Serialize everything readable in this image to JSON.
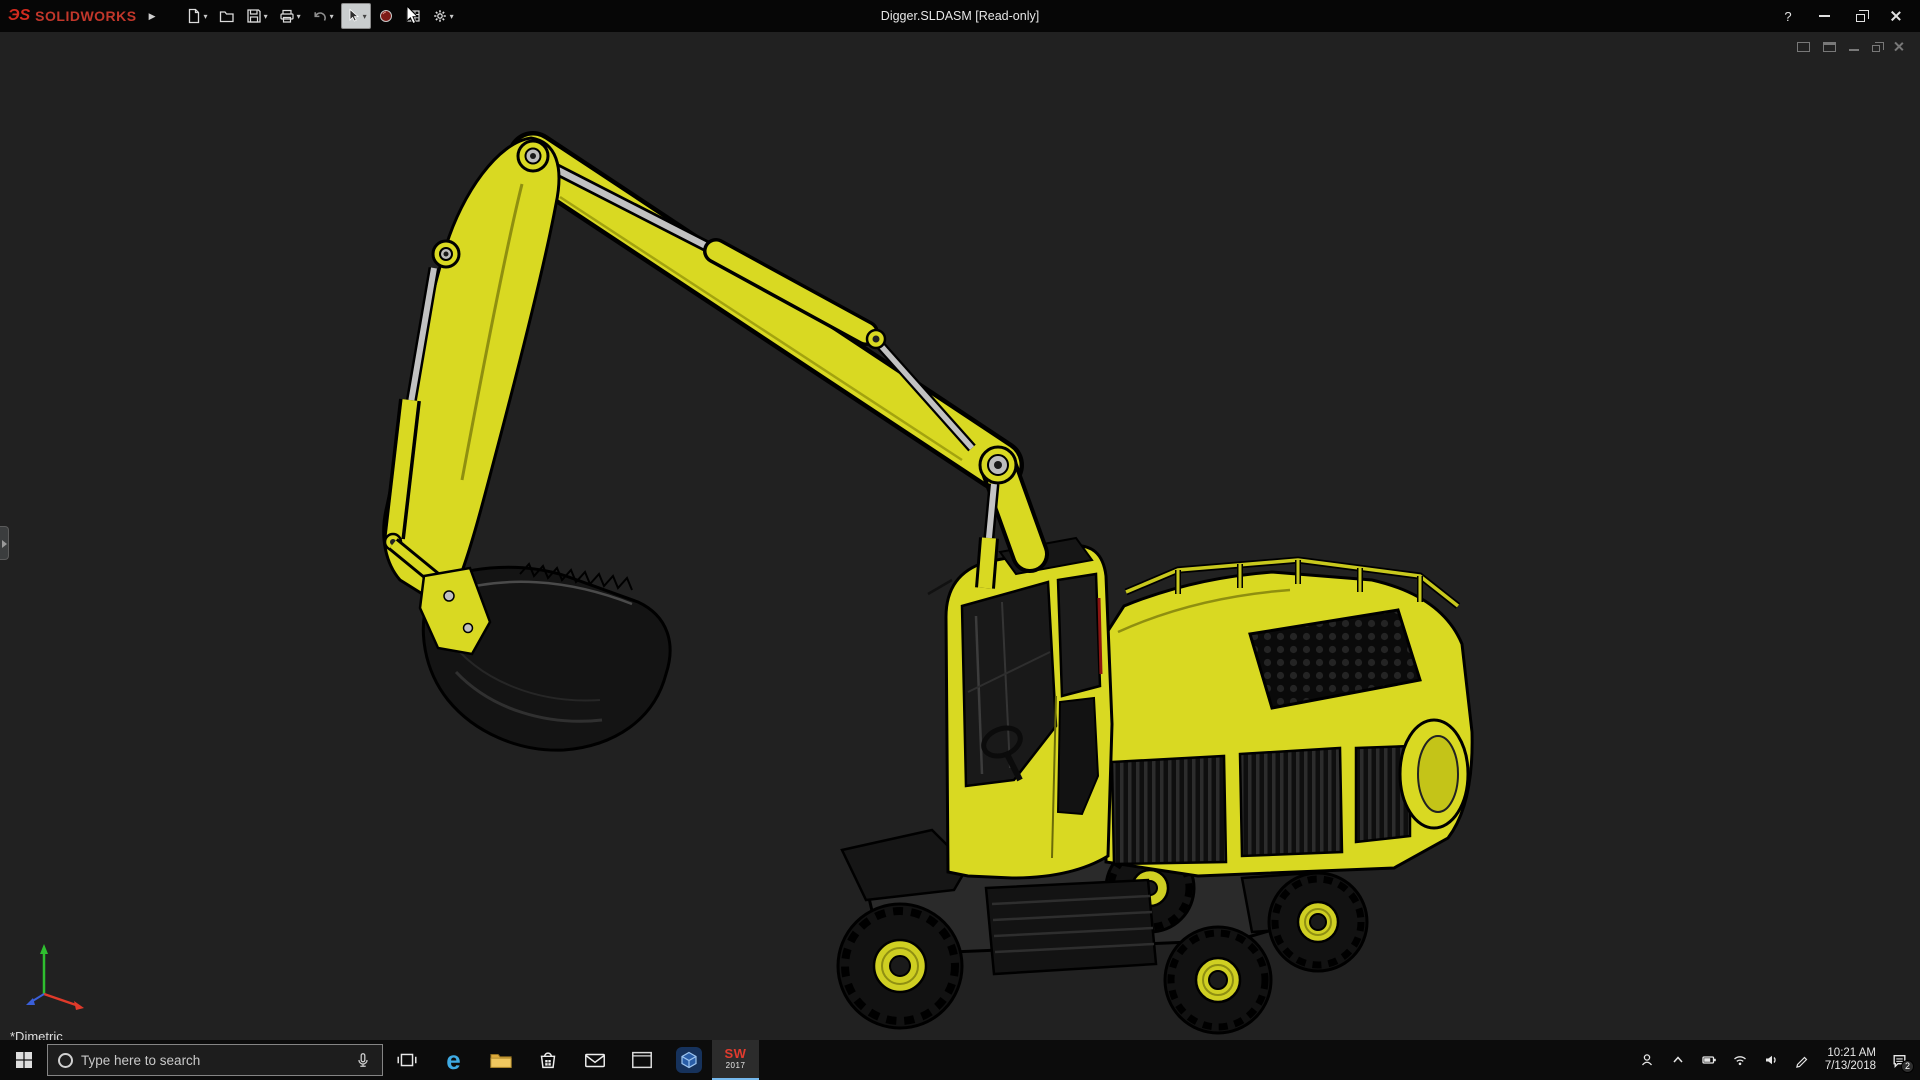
{
  "titlebar": {
    "logo_glyph": "ЭS",
    "brand": "SOLIDWORKS",
    "document_title": "Digger.SLDASM [Read-only]",
    "help_label": "?"
  },
  "glyphs": {
    "dropdown_caret": "▾",
    "flyout_arrow": "▶"
  },
  "toolbar": {
    "buttons": [
      "new-document",
      "open",
      "save",
      "print",
      "undo",
      "select",
      "rebuild",
      "file-properties",
      "options"
    ]
  },
  "viewport": {
    "orientation_label": "*Dimetric"
  },
  "taskbar": {
    "search_placeholder": "Type here to search",
    "edge_glyph": "e",
    "sw_icon_top": "SW",
    "sw_icon_year": "2017",
    "time": "10:21 AM",
    "date": "7/13/2018",
    "action_badge": "2"
  },
  "colors": {
    "excavator_yellow": "#d9d922",
    "brand_red": "#c2372b",
    "viewport_background": "#212121",
    "taskbar_background": "#0c0c0c",
    "active_app_underline": "#76b9ed"
  }
}
